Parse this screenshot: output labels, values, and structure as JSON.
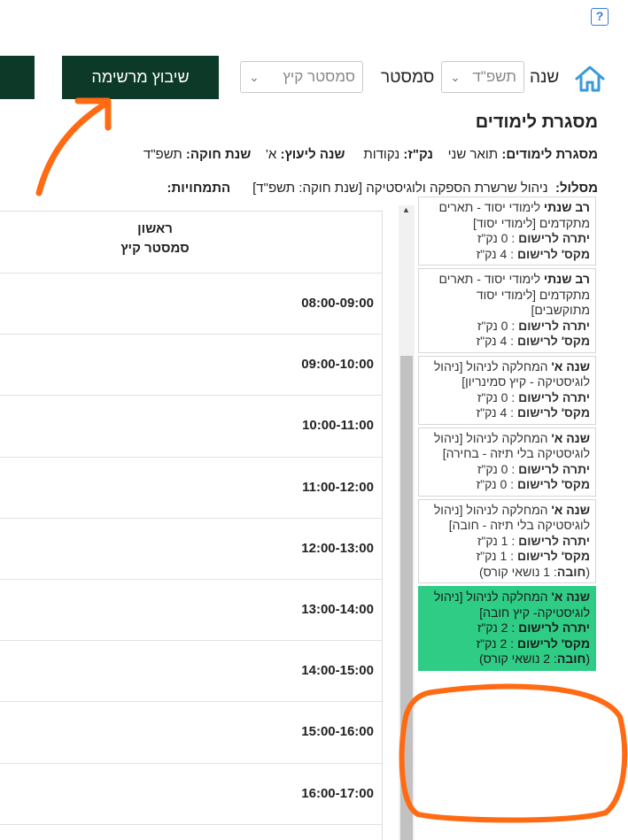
{
  "topbar": {
    "help_glyph": "?",
    "year_label": "שנה",
    "year_value": "תשפ\"ד",
    "semester_label": "סמסטר",
    "semester_value": "סמסטר קיץ",
    "plan_button": "שיבוץ מרשימה"
  },
  "framework": {
    "title": "מסגרת לימודים",
    "line1": {
      "fw_label": "מסגרת לימודים:",
      "fw_value": "תואר שני",
      "credits_label": "נק\"ז:",
      "credits_value": "נקודות",
      "adv_label": "שנה ליעוץ:",
      "adv_value": "א'",
      "law_label": "שנת חוקה:",
      "law_value": "תשפ\"ד"
    },
    "line2": {
      "track_label": "מסלול:",
      "track_value": "ניהול שרשרת הספקה ולוגיסטיקה [שנת חוקה: תשפ\"ד]",
      "spec_label": "התמחויות:"
    }
  },
  "schedule": {
    "column": {
      "day": "ראשון",
      "semester": "סמסטר קיץ"
    },
    "slots": [
      "08:00-09:00",
      "09:00-10:00",
      "10:00-11:00",
      "11:00-12:00",
      "12:00-13:00",
      "13:00-14:00",
      "14:00-15:00",
      "15:00-16:00",
      "16:00-17:00"
    ]
  },
  "cards": [
    {
      "head": "רב שנתי",
      "text": "לימודי יסוד - תארים מתקדמים [לימודי יסוד]",
      "bal_label": "יתרה לרישום",
      "bal": ": 0 נק\"ז",
      "max_label": "מקס' לרישום",
      "max": ": 4 נק\"ז",
      "req_label": "",
      "req": "",
      "highlight": false
    },
    {
      "head": "רב שנתי",
      "text": "לימודי יסוד - תארים מתקדמים [לימודי יסוד מתוקשבים]",
      "bal_label": "יתרה לרישום",
      "bal": ": 0 נק\"ז",
      "max_label": "מקס' לרישום",
      "max": ": 4 נק\"ז",
      "req_label": "",
      "req": "",
      "highlight": false
    },
    {
      "head": "שנה א'",
      "text": "המחלקה לניהול [ניהול לוגיסטיקה - קיץ סמינריון]",
      "bal_label": "יתרה לרישום",
      "bal": ": 0 נק\"ז",
      "max_label": "מקס' לרישום",
      "max": ": 4 נק\"ז",
      "req_label": "",
      "req": "",
      "highlight": false
    },
    {
      "head": "שנה א'",
      "text": "המחלקה לניהול [ניהול לוגיסטיקה בלי תיזה - בחירה]",
      "bal_label": "יתרה לרישום",
      "bal": ": 0 נק\"ז",
      "max_label": "מקס' לרישום",
      "max": ": 0 נק\"ז",
      "req_label": "",
      "req": "",
      "highlight": false
    },
    {
      "head": "שנה א'",
      "text": "המחלקה לניהול [ניהול לוגיסטיקה בלי תיזה - חובה]",
      "bal_label": "יתרה לרישום",
      "bal": ": 1 נק\"ז",
      "max_label": "מקס' לרישום",
      "max": ": 1 נק\"ז",
      "req_label": "חובה",
      "req": ": 1 נושאי קורס)",
      "highlight": false
    },
    {
      "head": "שנה א'",
      "text": "המחלקה לניהול [ניהול לוגיסטיקה- קיץ חובה]",
      "bal_label": "יתרה לרישום",
      "bal": ": 2 נק\"ז",
      "max_label": "מקס' לרישום",
      "max": ": 2 נק\"ז",
      "req_label": "חובה",
      "req": ": 2 נושאי קורס)",
      "highlight": true
    }
  ],
  "colors": {
    "dark_green": "#0d3a28",
    "highlight_green": "#2ecc85",
    "annotation_orange": "#ff6a13",
    "home_blue": "#3a9ad9"
  }
}
